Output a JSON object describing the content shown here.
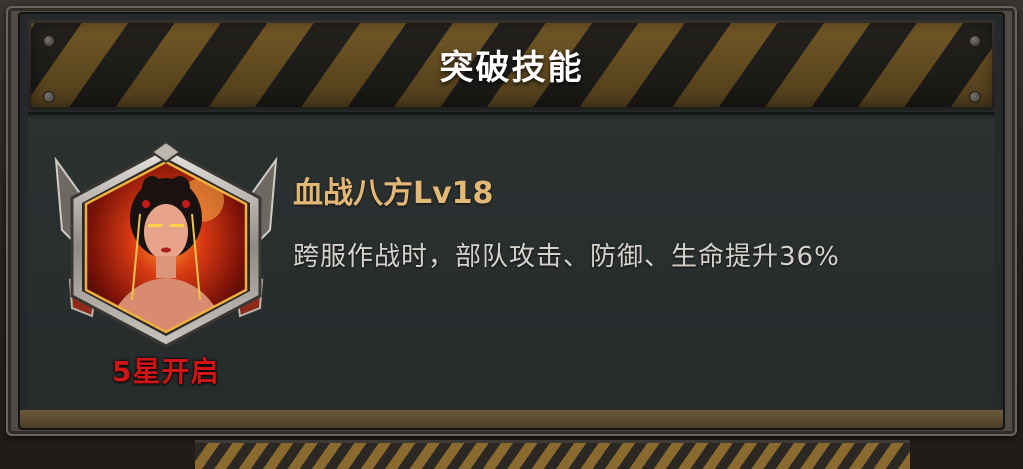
{
  "panel": {
    "title": "突破技能"
  },
  "skill": {
    "name": "血战八方Lv18",
    "description": "跨服作战时，部队攻击、防御、生命提升36%",
    "unlock_label": "5星开启",
    "portrait_icon": "hero-portrait-icon"
  },
  "colors": {
    "title_text": "#ffffff",
    "skill_name": "#e3b774",
    "description": "#d6d2cb",
    "unlock_label": "#d11515",
    "hazard_stripe_gold": "#8a6a2e",
    "hazard_stripe_dark": "#2b2824",
    "panel_bg": "#2b3031"
  }
}
